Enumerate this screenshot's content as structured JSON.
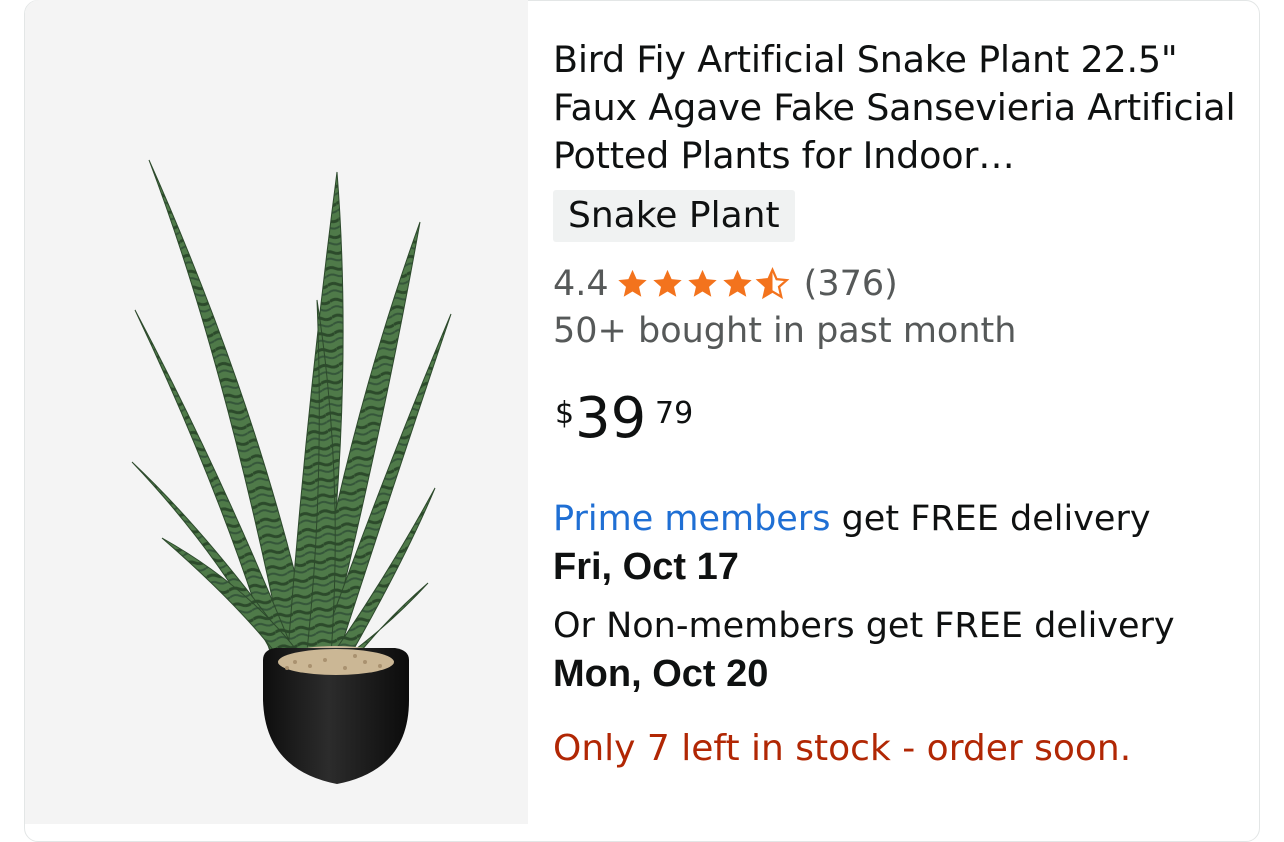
{
  "product": {
    "title": "Bird Fiy Artificial Snake Plant 22.5\" Faux Agave Fake Sansevieria Artificial Potted Plants for Indoor…",
    "variant": "Snake Plant",
    "rating_value": "4.4",
    "rating_stars": 4.4,
    "review_count": "(376)",
    "bought_text": "50+ bought in past month",
    "price": {
      "currency": "$",
      "whole": "39",
      "fraction": "79"
    },
    "prime_delivery": {
      "link_text": "Prime members",
      "text": " get FREE delivery",
      "date": "Fri, Oct 17"
    },
    "nonmember_delivery": {
      "text": "Or Non-members get FREE delivery",
      "date": "Mon, Oct 20"
    },
    "stock_text": "Only 7 left in stock - order soon."
  },
  "colors": {
    "star": "#f3731d",
    "prime_link": "#1f6fd4",
    "stock": "#b12704",
    "secondary_text": "#565959"
  },
  "icons": {
    "star": "star-icon"
  }
}
